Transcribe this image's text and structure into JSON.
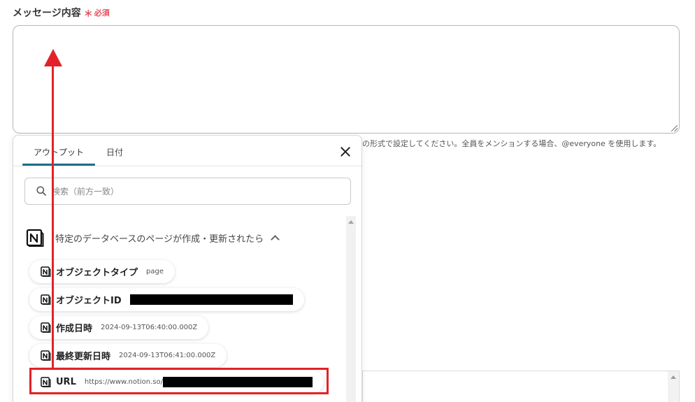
{
  "form": {
    "message_label": "メッセージ内容",
    "required_mark": "＊",
    "required_text": "必須",
    "help_text": "の形式で設定してください。全員をメンションする場合、@everyone を使用します。"
  },
  "popup": {
    "tabs": [
      {
        "label": "アウトプット",
        "active": true
      },
      {
        "label": "日付",
        "active": false
      }
    ],
    "search": {
      "placeholder": "検索（前方一致）",
      "value": ""
    },
    "group": {
      "icon": "notion-icon",
      "title": "特定のデータベースのページが作成・更新されたら",
      "expanded": true
    },
    "items": [
      {
        "icon": "notion-icon",
        "label": "オブジェクトタイプ",
        "value": "page"
      },
      {
        "icon": "notion-icon",
        "label": "オブジェクトID",
        "value": ""
      },
      {
        "icon": "notion-icon",
        "label": "作成日時",
        "value": "2024-09-13T06:40:00.000Z"
      },
      {
        "icon": "notion-icon",
        "label": "最終更新日時",
        "value": "2024-09-13T06:41:00.000Z"
      },
      {
        "icon": "notion-icon",
        "label": "URL",
        "value": "https://www.notion.so/"
      }
    ]
  },
  "annotation": {
    "color": "#e32227",
    "accent": "#1d6e85"
  }
}
